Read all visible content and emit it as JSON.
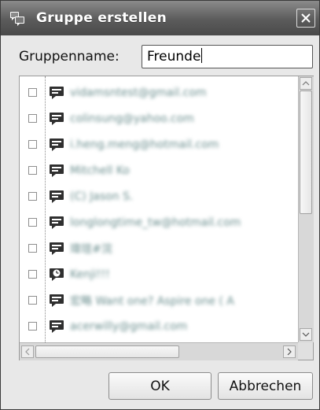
{
  "window": {
    "title": "Gruppe erstellen",
    "title_icon": "group-chat-icon",
    "close_icon": "close-icon"
  },
  "group_name": {
    "label": "Gruppenname:",
    "value": "Freunde"
  },
  "contacts": [
    {
      "name": "vidamsntest@gmail.com",
      "icon": "chat-bubble-icon",
      "checked": false
    },
    {
      "name": "colinsung@yahoo.com",
      "icon": "chat-bubble-icon",
      "checked": false
    },
    {
      "name": "i.heng.meng@hotmail.com",
      "icon": "chat-bubble-icon",
      "checked": false
    },
    {
      "name": "Mitchell Ko",
      "icon": "chat-bubble-icon",
      "checked": false
    },
    {
      "name": "(C) Jason S.",
      "icon": "chat-bubble-icon",
      "checked": false
    },
    {
      "name": "longlongtime_tw@hotmail.com",
      "icon": "chat-bubble-icon",
      "checked": false
    },
    {
      "name": "瑋瑄#浣",
      "icon": "chat-bubble-icon",
      "checked": false
    },
    {
      "name": "Kenji!!!",
      "icon": "away-clock-icon",
      "checked": false
    },
    {
      "name": "宏略 Want one? Aspire one ( A",
      "icon": "chat-bubble-icon",
      "checked": false
    },
    {
      "name": "acerwilly@gmail.com",
      "icon": "chat-bubble-icon",
      "checked": false
    }
  ],
  "buttons": {
    "ok": "OK",
    "cancel": "Abbrechen"
  },
  "colors": {
    "titlebar": "#5b5b5b",
    "dialog_bg": "#e8e8e8",
    "contact_text": "#6a8e8e"
  }
}
